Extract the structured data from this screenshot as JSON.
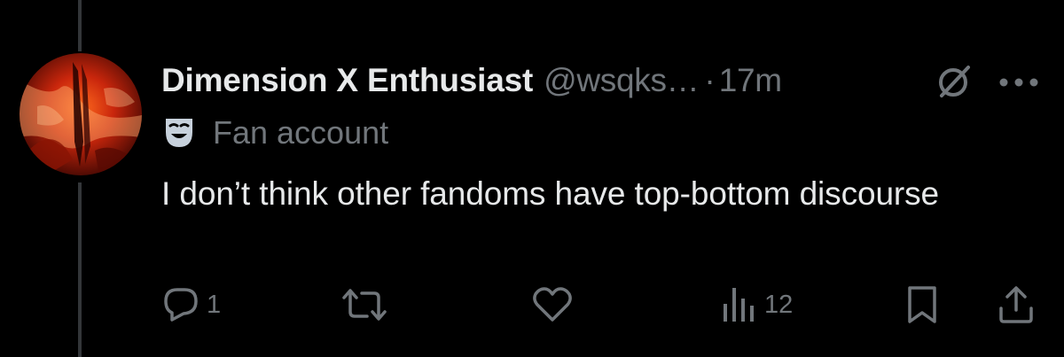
{
  "tweet": {
    "display_name": "Dimension X Enthusiast",
    "handle": "@wsqks…",
    "separator": "·",
    "time": "17m",
    "label": "Fan account",
    "text": "I don’t think other fandoms have top-bottom discourse"
  },
  "actions": {
    "reply_count": "1",
    "views_count": "12"
  },
  "icons": {
    "avatar": "avatar-image",
    "grok": "grok-icon",
    "more": "more-options-icon",
    "label": "theater-mask-icon",
    "reply": "reply-icon",
    "retweet": "retweet-icon",
    "like": "heart-icon",
    "views": "views-icon",
    "bookmark": "bookmark-icon",
    "share": "share-icon"
  },
  "colors": {
    "background": "#000000",
    "text_primary": "#e7e9ea",
    "text_secondary": "#71767b",
    "thread_line": "#333639"
  }
}
